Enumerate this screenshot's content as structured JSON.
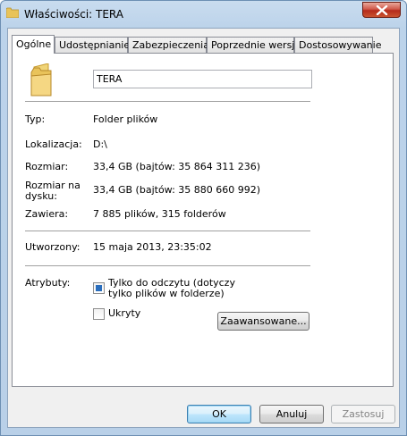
{
  "window": {
    "title": "Właściwości: TERA"
  },
  "tabs": [
    {
      "label": "Ogólne"
    },
    {
      "label": "Udostępnianie"
    },
    {
      "label": "Zabezpieczenia"
    },
    {
      "label": "Poprzednie wersje"
    },
    {
      "label": "Dostosowywanie"
    }
  ],
  "general": {
    "name_value": "TERA",
    "type_label": "Typ:",
    "type_value": "Folder plików",
    "location_label": "Lokalizacja:",
    "location_value": "D:\\",
    "size_label": "Rozmiar:",
    "size_value": "33,4 GB (bajtów: 35 864 311 236)",
    "size_on_disk_label_1": "Rozmiar na",
    "size_on_disk_label_2": "dysku:",
    "size_on_disk_value": "33,4 GB (bajtów: 35 880 660 992)",
    "contains_label": "Zawiera:",
    "contains_value": "7 885 plików, 315 folderów",
    "created_label": "Utworzony:",
    "created_value": "15 maja 2013, 23:35:02",
    "attributes_label": "Atrybuty:",
    "readonly_label_1": "Tylko do odczytu (dotyczy",
    "readonly_label_2": "tylko plików w folderze)",
    "hidden_label": "Ukryty",
    "advanced_button": "Zaawansowane..."
  },
  "buttons": {
    "ok": "OK",
    "cancel": "Anuluj",
    "apply": "Zastosuj"
  },
  "colors": {
    "accent": "#2a6ebd",
    "title_bar": "#bcd3ea",
    "close_button": "#c7432f"
  }
}
